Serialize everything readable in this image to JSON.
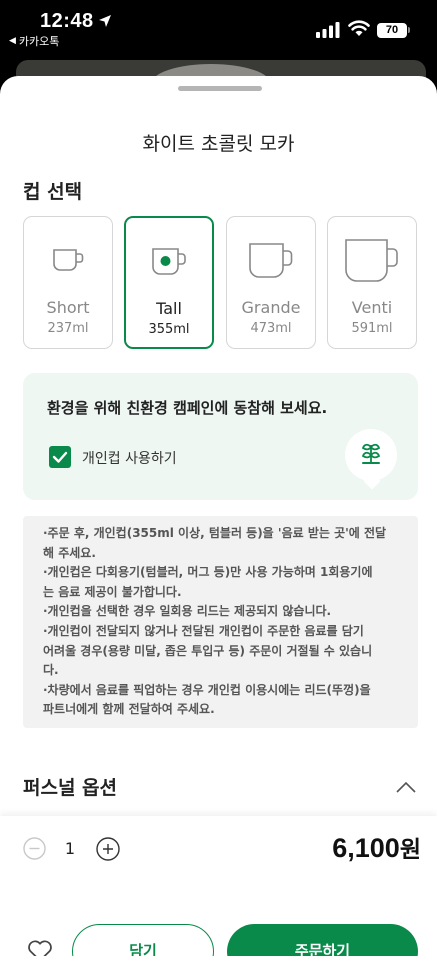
{
  "status_bar": {
    "time": "12:48",
    "back_app": "카카오톡",
    "battery": "70"
  },
  "sheet": {
    "title": "화이트 초콜릿 모카"
  },
  "cup_section": {
    "heading": "컵 선택",
    "options": [
      {
        "label": "Short",
        "volume": "237ml",
        "selected": false
      },
      {
        "label": "Tall",
        "volume": "355ml",
        "selected": true
      },
      {
        "label": "Grande",
        "volume": "473ml",
        "selected": false
      },
      {
        "label": "Venti",
        "volume": "591ml",
        "selected": false
      }
    ]
  },
  "eco": {
    "title": "환경을 위해 친환경 캠페인에 동참해 보세요.",
    "checkbox_label": "개인컵 사용하기",
    "checked": true,
    "icon": "plant-icon"
  },
  "notice": {
    "lines": [
      "·주문 후, 개인컵(355ml 이상, 텀블러 등)을 '음료 받는 곳'에 전달",
      "해 주세요.",
      "·개인컵은 다회용기(텀블러, 머그 등)만 사용 가능하며 1회용기에",
      "는 음료 제공이 불가합니다.",
      "·개인컵을 선택한 경우 일회용 리드는 제공되지 않습니다.",
      "·개인컵이 전달되지 않거나 전달된 개인컵이 주문한 음료를 담기",
      "어려울 경우(용량 미달, 좁은 투입구 등) 주문이 거절될 수 있습니",
      "다.",
      "·차량에서 음료를 픽업하는 경우 개인컵 이용시에는 리드(뚜껑)을",
      "파트너에게 함께 전달하여 주세요."
    ]
  },
  "personal_options": {
    "heading": "퍼스널 옵션"
  },
  "bottom": {
    "quantity": "1",
    "price": "6,100",
    "currency": "원",
    "cart_label": "담기",
    "order_label": "주문하기"
  },
  "colors": {
    "accent": "#0a8a4a",
    "eco_bg": "#eef7f2",
    "notice_bg": "#f2f2f2"
  }
}
